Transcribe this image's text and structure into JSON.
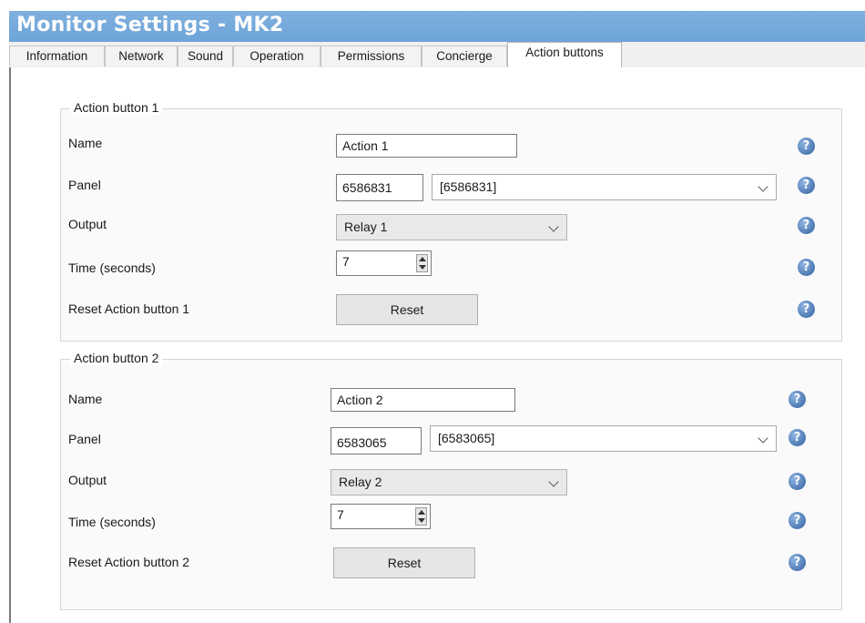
{
  "window": {
    "title": "Monitor Settings - MK2"
  },
  "tabs": [
    {
      "label": "Information"
    },
    {
      "label": "Network"
    },
    {
      "label": "Sound"
    },
    {
      "label": "Operation"
    },
    {
      "label": "Permissions"
    },
    {
      "label": "Concierge"
    },
    {
      "label": "Action buttons",
      "active": true
    }
  ],
  "help_glyph": "?",
  "groups": [
    {
      "title": "Action button 1",
      "name_label": "Name",
      "name_value": "Action 1",
      "panel_label": "Panel",
      "panel_id": "6586831",
      "panel_select": "[6586831]",
      "output_label": "Output",
      "output_value": "Relay 1",
      "time_label": "Time (seconds)",
      "time_value": "7",
      "reset_label": "Reset Action button 1",
      "reset_button": "Reset"
    },
    {
      "title": "Action button 2",
      "name_label": "Name",
      "name_value": "Action 2",
      "panel_label": "Panel",
      "panel_id": "6583065",
      "panel_select": "[6583065]",
      "output_label": "Output",
      "output_value": "Relay 2",
      "time_label": "Time (seconds)",
      "time_value": "7",
      "reset_label": "Reset Action button 2",
      "reset_button": "Reset"
    }
  ]
}
